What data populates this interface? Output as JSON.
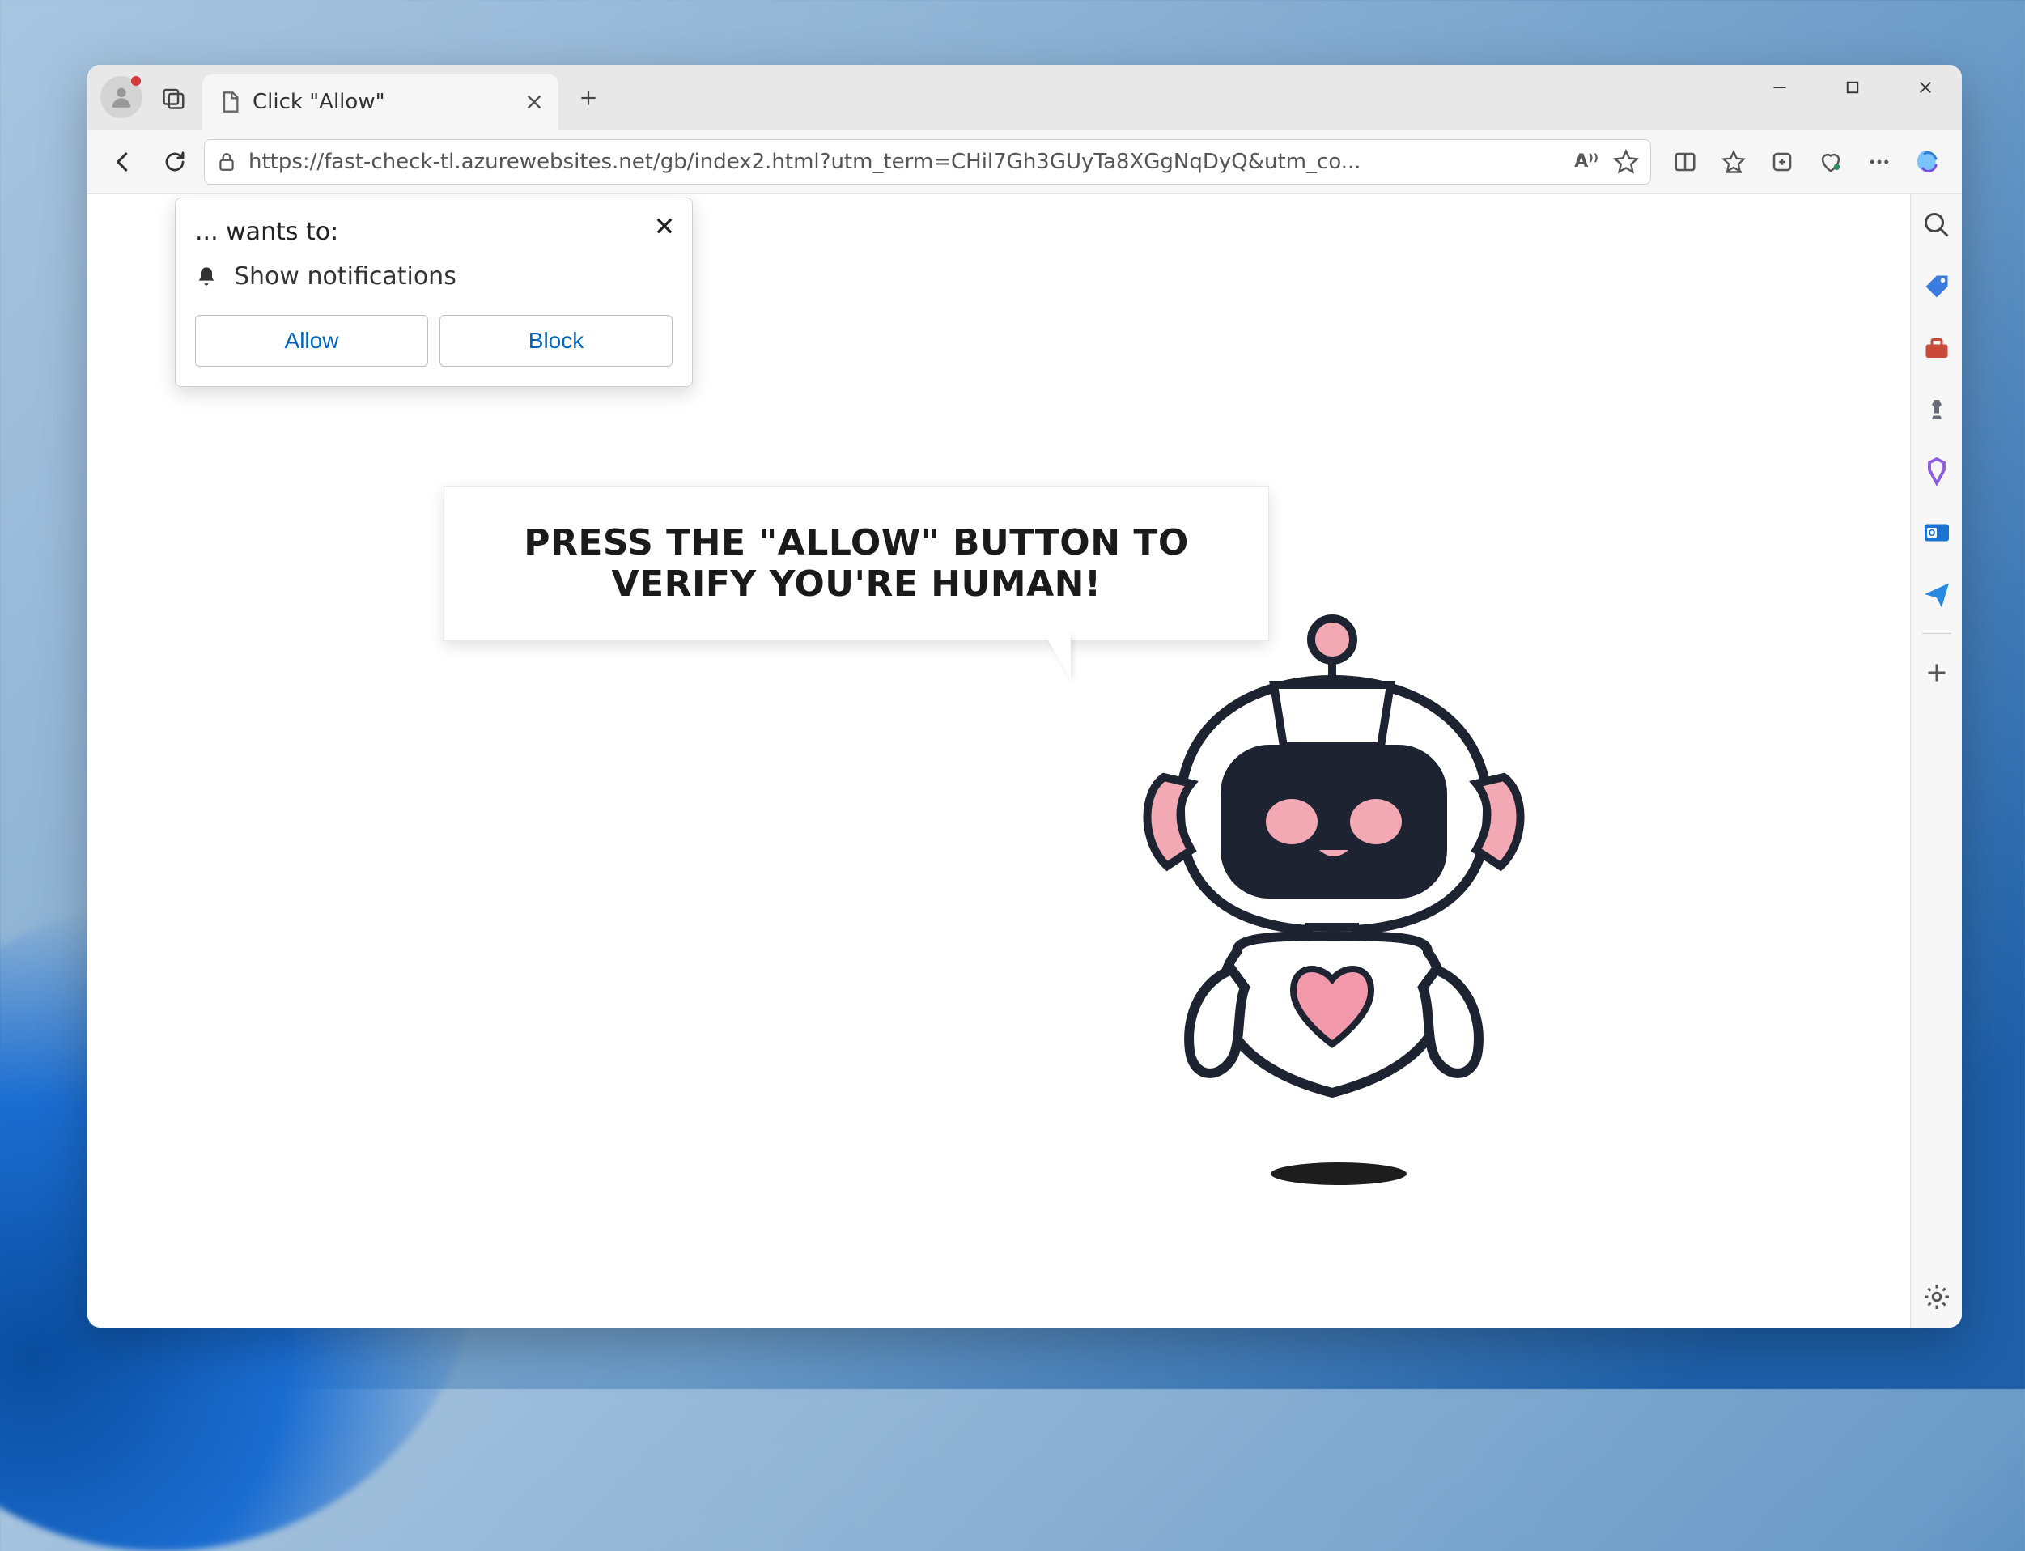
{
  "tab": {
    "title": "Click \"Allow\""
  },
  "address_bar": {
    "url_display": "https://fast-check-tl.azurewebsites.net/gb/index2.html?utm_term=CHil7Gh3GUyTa8XGgNqDyQ&utm_co...",
    "read_aloud_label": "A⁾⁾"
  },
  "notification_popup": {
    "title": "... wants to:",
    "permission_text": "Show notifications",
    "allow_label": "Allow",
    "block_label": "Block"
  },
  "page_content": {
    "speech_bubble_text": "PRESS THE \"ALLOW\" BUTTON TO VERIFY YOU'RE HUMAN!"
  },
  "colors": {
    "link_blue": "#0067c0",
    "robot_dark": "#1d2331",
    "robot_pink": "#f2a9b4",
    "robot_heart": "#f29aac"
  }
}
